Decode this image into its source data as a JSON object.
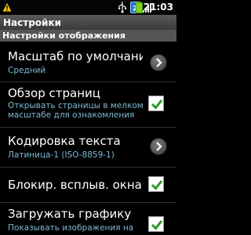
{
  "status_bar": {
    "time": "21:03",
    "icons": [
      "warning-icon",
      "usb-icon",
      "sim-icon",
      "signal-icon",
      "battery-icon"
    ]
  },
  "title": "Настройки",
  "section_header": "Настройки отображения",
  "items": [
    {
      "title": "Масштаб по умолчанию",
      "subtitle": "Средний",
      "control": "chevron"
    },
    {
      "title": "Обзор страниц",
      "subtitle_lines": [
        "Открывать страницы в мелком",
        "масштабе для ознакомления"
      ],
      "control": "checkbox",
      "checked": true
    },
    {
      "title": "Кодировка текста",
      "subtitle": "Латиница-1 (ISO-8859-1)",
      "control": "chevron"
    },
    {
      "title": "Блокир. всплыв. окна",
      "control": "checkbox",
      "checked": true
    },
    {
      "title": "Загружать графику",
      "subtitle": "Показывать изображения на",
      "control": "checkbox",
      "checked": true
    }
  ],
  "colors": {
    "subtitle": "#7fb8d4",
    "check": "#2a9a2a",
    "section_bg": "#555555"
  }
}
